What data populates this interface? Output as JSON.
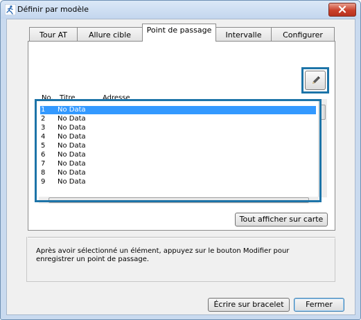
{
  "window": {
    "title": "Définir par modèle"
  },
  "tabs": [
    {
      "label": "Tour AT"
    },
    {
      "label": "Allure cible"
    },
    {
      "label": "Point de passage"
    },
    {
      "label": "Intervalle"
    },
    {
      "label": "Configurer"
    }
  ],
  "list": {
    "columns": [
      "No.",
      "Titre",
      "Adresse"
    ],
    "rows": [
      {
        "no": "1",
        "title": "No Data"
      },
      {
        "no": "2",
        "title": "No Data"
      },
      {
        "no": "3",
        "title": "No Data"
      },
      {
        "no": "4",
        "title": "No Data"
      },
      {
        "no": "5",
        "title": "No Data"
      },
      {
        "no": "6",
        "title": "No Data"
      },
      {
        "no": "7",
        "title": "No Data"
      },
      {
        "no": "8",
        "title": "No Data"
      },
      {
        "no": "9",
        "title": "No Data"
      }
    ]
  },
  "buttons": {
    "show_all_on_map": "Tout afficher sur carte",
    "write_to_bracelet": "Écrire sur bracelet",
    "close": "Fermer"
  },
  "info_text": "Après avoir sélectionné un élément, appuyez sur le bouton Modifier pour enregistrer un point de passage.",
  "colors": {
    "highlight": "#1d74a8",
    "selection": "#3399ff"
  },
  "icons": {
    "edit": "pencil-icon",
    "close": "close-icon",
    "app": "runner-icon"
  }
}
